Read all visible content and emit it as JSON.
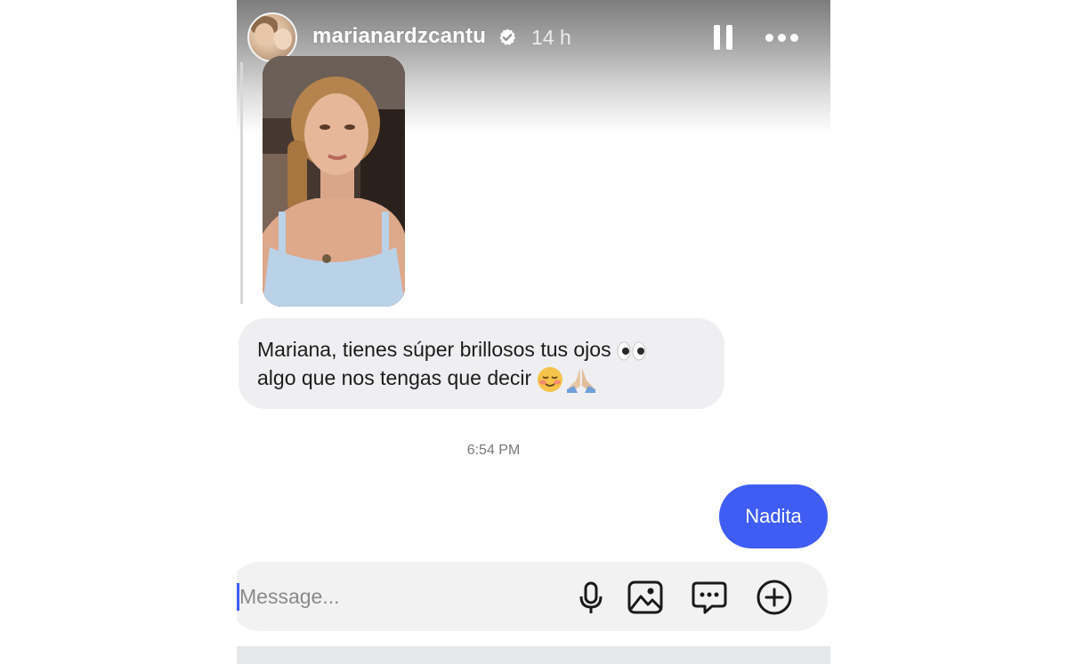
{
  "story": {
    "username": "marianardzcantu",
    "time_ago": "14 h",
    "verified": true
  },
  "colors": {
    "accent": "#3f5cf5",
    "received_bubble": "#efeff2",
    "composer_bg": "#f2f2f2"
  },
  "chat": {
    "shared_photo_alt": "",
    "received_message": {
      "line1": "Mariana, tienes súper brillosos tus ojos",
      "line1_emoji": "eyes-emoji",
      "line2": "algo que nos tengas que decir",
      "line2_emojis": [
        "relieved-face-emoji",
        "folded-hands-emoji"
      ]
    },
    "timestamp": "6:54 PM",
    "sent_message": "Nadita"
  },
  "composer": {
    "placeholder": "Message...",
    "icons": [
      "microphone-icon",
      "image-icon",
      "chat-bubble-icon",
      "add-icon"
    ]
  }
}
